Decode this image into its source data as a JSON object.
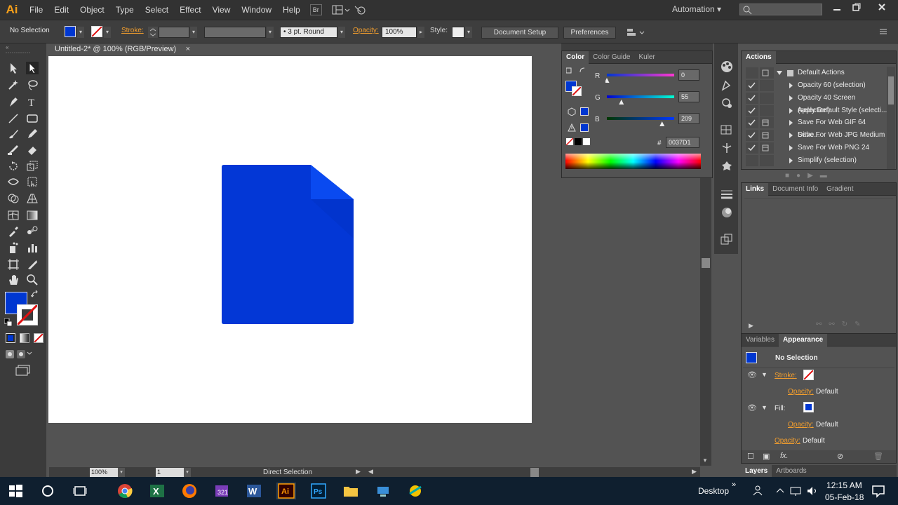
{
  "app": {
    "logo": "Ai",
    "workspace": "Automation",
    "search_placeholder": ""
  },
  "menu": [
    "File",
    "Edit",
    "Object",
    "Type",
    "Select",
    "Effect",
    "View",
    "Window",
    "Help"
  ],
  "menu_buttons": [
    "Br"
  ],
  "control_bar": {
    "selection": "No Selection",
    "stroke_label": "Stroke:",
    "brush": "3 pt. Round",
    "opacity_label": "Opacity:",
    "opacity_value": "100%",
    "style_label": "Style:",
    "document_setup": "Document Setup",
    "preferences": "Preferences"
  },
  "document": {
    "tab_title": "Untitled-2* @ 100% (RGB/Preview)",
    "close": "×"
  },
  "status": {
    "zoom": "100%",
    "artboard": "1",
    "tool": "Direct Selection"
  },
  "color_panel": {
    "tabs": [
      "Color",
      "Color Guide",
      "Kuler"
    ],
    "r_label": "R",
    "g_label": "G",
    "b_label": "B",
    "r": 0,
    "g": 55,
    "b": 209,
    "r_text": "0",
    "g_text": "55",
    "b_text": "209",
    "hex_label": "#",
    "hex": "0037D1",
    "fill_color": "#0037d1"
  },
  "actions_panel": {
    "title": "Actions",
    "set_name": "Default Actions",
    "items": [
      "Opacity 60 (selection)",
      "Opacity 40 Screen (selection)",
      "Apply Default Style (selecti...",
      "Save For Web GIF 64 Dithe...",
      "Save For Web JPG Medium",
      "Save For Web PNG 24",
      "Simplify (selection)"
    ]
  },
  "links_panel": {
    "tabs": [
      "Links",
      "Document Info",
      "Gradient"
    ]
  },
  "appearance_panel": {
    "tabs": [
      "Variables",
      "Appearance"
    ],
    "heading": "No Selection",
    "stroke_label": "Stroke:",
    "opacity_label": "Opacity:",
    "opacity_value": "Default",
    "fill_label": "Fill:",
    "opacity2_label": "Opacity:",
    "opacity2_value": "Default",
    "opacity3_label": "Opacity:",
    "opacity3_value": "Default",
    "fx": "fx."
  },
  "layers_panel": {
    "tabs": [
      "Layers",
      "Artboards"
    ]
  },
  "taskbar": {
    "desktop": "Desktop",
    "time": "12:15 AM",
    "date": "05-Feb-18",
    "chevron": "»"
  },
  "colors": {
    "accent_blue": "#0037d1",
    "ai_orange": "#f7a01a",
    "doc_shape": "#0337d6",
    "doc_fold": "#0a4af0"
  }
}
